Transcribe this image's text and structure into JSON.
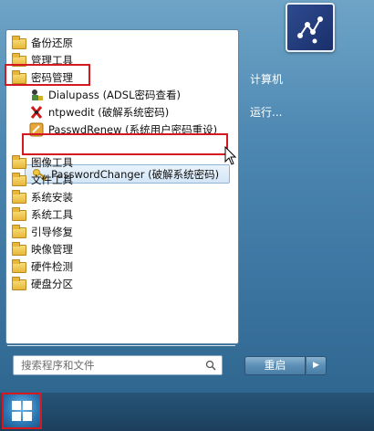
{
  "programs": {
    "folders_top": [
      {
        "label": "备份还原"
      },
      {
        "label": "管理工具"
      },
      {
        "label": "密码管理"
      }
    ],
    "password_tools": [
      {
        "label": "Dialupass (ADSL密码查看)",
        "icon": "dialupass-icon"
      },
      {
        "label": "ntpwedit (破解系统密码)",
        "icon": "ntpwedit-icon"
      },
      {
        "label": "PasswdRenew (系统用户密码重设)",
        "icon": "passwdrenew-icon"
      },
      {
        "label": "PasswordChanger (破解系统密码)",
        "icon": "key-icon"
      }
    ],
    "folders_bottom": [
      {
        "label": "图像工具"
      },
      {
        "label": "文件工具"
      },
      {
        "label": "系统安装"
      },
      {
        "label": "系统工具"
      },
      {
        "label": "引导修复"
      },
      {
        "label": "映像管理"
      },
      {
        "label": "硬件检测"
      },
      {
        "label": "硬盘分区"
      }
    ]
  },
  "search": {
    "placeholder": "搜索程序和文件"
  },
  "right_pane": {
    "computer": "计算机",
    "run": "运行..."
  },
  "restart": {
    "label": "重启",
    "arrow": "▶"
  },
  "colors": {
    "highlight_red": "#d6191f",
    "folder_yellow": "#e8b73a",
    "menu_blue": "#4d88b2"
  }
}
